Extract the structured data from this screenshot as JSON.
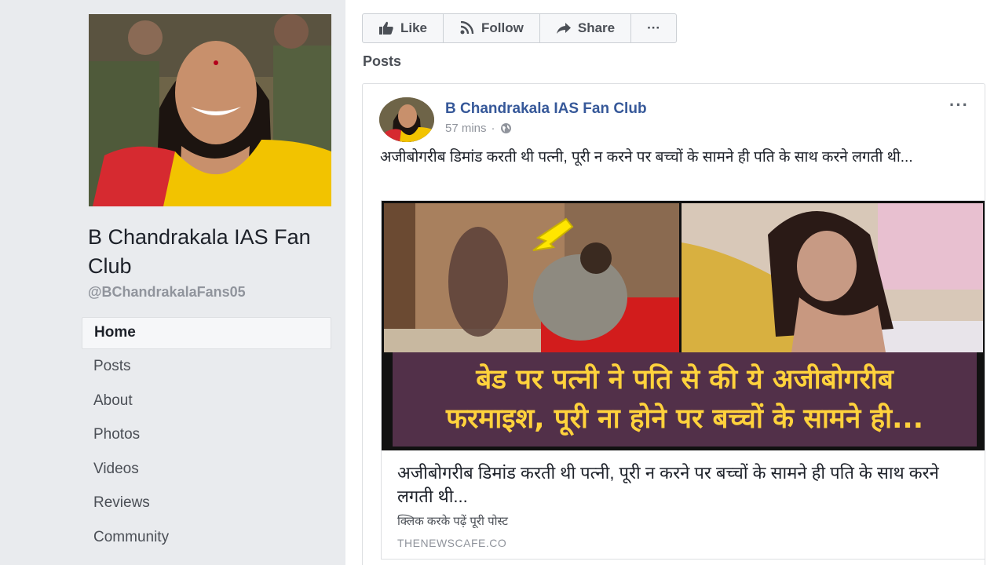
{
  "page": {
    "name": "B Chandrakala IAS Fan Club",
    "handle": "@BChandrakalaFans05"
  },
  "nav": {
    "items": [
      {
        "label": "Home",
        "active": true
      },
      {
        "label": "Posts"
      },
      {
        "label": "About"
      },
      {
        "label": "Photos"
      },
      {
        "label": "Videos"
      },
      {
        "label": "Reviews"
      },
      {
        "label": "Community"
      }
    ]
  },
  "actions": {
    "like": "Like",
    "follow": "Follow",
    "share": "Share",
    "more": "···"
  },
  "posts_heading": "Posts",
  "post": {
    "author": "B Chandrakala IAS Fan Club",
    "time": "57 mins",
    "separator": "·",
    "more": "···",
    "text": "अजीबोगरीब डिमांड करती थी पत्नी, पूरी न करने पर बच्चों के सामने ही पति के साथ करने लगती थी...",
    "link": {
      "banner_line1": "बेड पर पत्नी ने पति से की ये अजीबोगरीब",
      "banner_line2": "फरमाइश, पूरी ना होने पर बच्चों के सामने ही...",
      "title": "अजीबोगरीब डिमांड करती थी पत्नी, पूरी न करने पर बच्चों के सामने ही पति के साथ करने लगती थी...",
      "description": "क्लिक करके पढ़ें पूरी पोस्ट",
      "domain": "THENEWSCAFE.CO"
    }
  },
  "colors": {
    "brand": "#4267b2",
    "link": "#365899",
    "banner_bg": "#523049",
    "banner_text": "#ffd23c",
    "arrow": "#ffe600"
  }
}
